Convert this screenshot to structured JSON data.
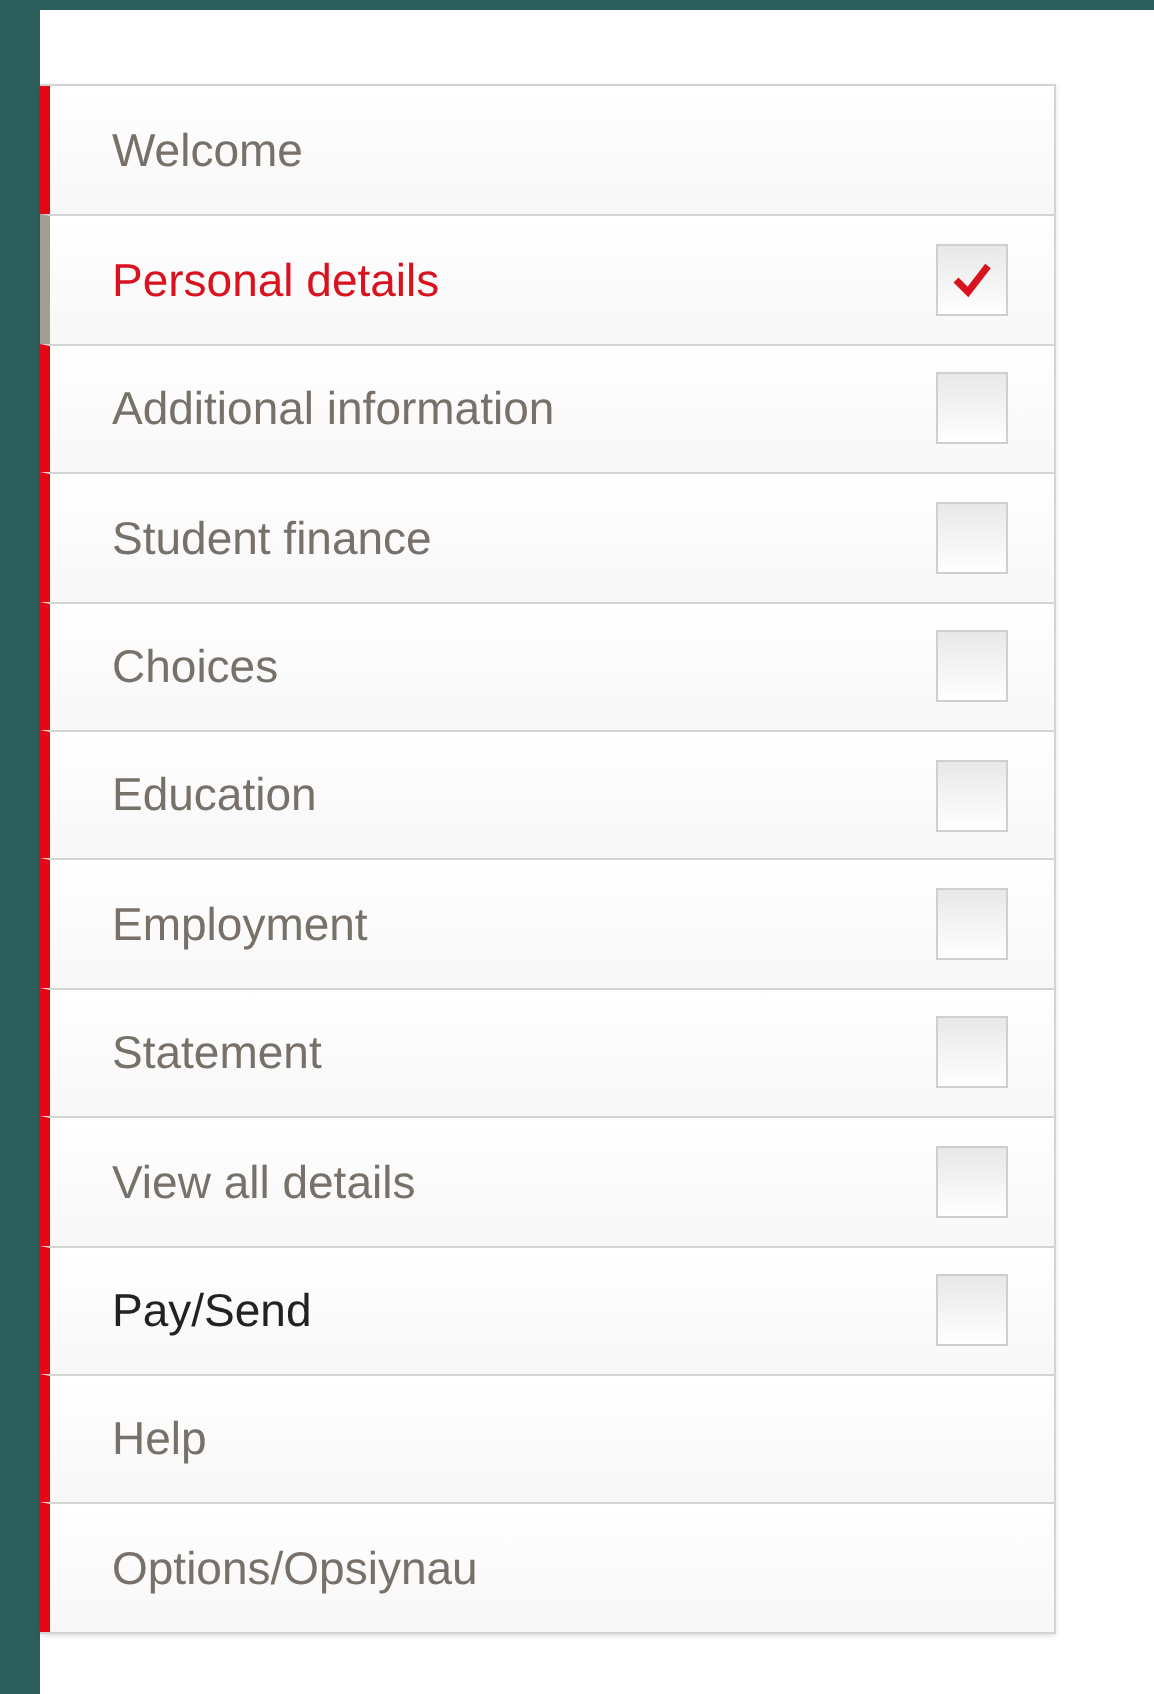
{
  "menu": {
    "items": [
      {
        "label": "Welcome",
        "kind": "link",
        "selected": false
      },
      {
        "label": "Personal details",
        "kind": "step",
        "selected": true,
        "checked": true,
        "dark": false
      },
      {
        "label": "Additional information",
        "kind": "step",
        "selected": false,
        "checked": false,
        "dark": false
      },
      {
        "label": "Student finance",
        "kind": "step",
        "selected": false,
        "checked": false,
        "dark": false
      },
      {
        "label": "Choices",
        "kind": "step",
        "selected": false,
        "checked": false,
        "dark": false
      },
      {
        "label": "Education",
        "kind": "step",
        "selected": false,
        "checked": false,
        "dark": false
      },
      {
        "label": "Employment",
        "kind": "step",
        "selected": false,
        "checked": false,
        "dark": false
      },
      {
        "label": "Statement",
        "kind": "step",
        "selected": false,
        "checked": false,
        "dark": false
      },
      {
        "label": "View all details",
        "kind": "step",
        "selected": false,
        "checked": false,
        "dark": false
      },
      {
        "label": "Pay/Send",
        "kind": "step",
        "selected": false,
        "checked": false,
        "dark": true
      },
      {
        "label": "Help",
        "kind": "link",
        "selected": false
      },
      {
        "label": "Options/Opsiynau",
        "kind": "link",
        "selected": false
      }
    ]
  }
}
